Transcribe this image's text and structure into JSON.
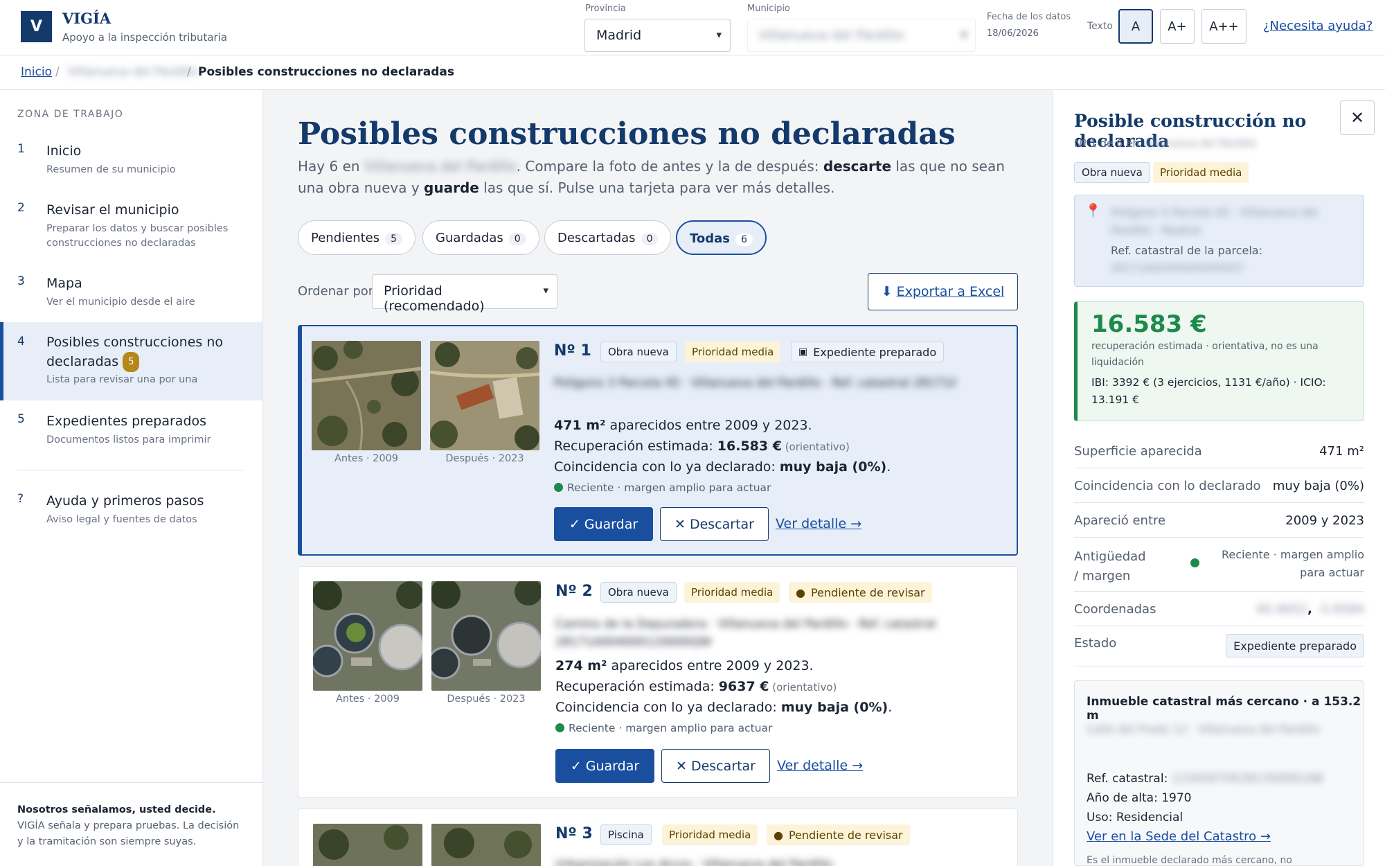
{
  "header": {
    "logo_letter": "V",
    "app_name": "VIGÍA",
    "app_sub": "Apoyo a la inspección tributaria",
    "provincia_label": "Provincia",
    "provincia_value": "Madrid",
    "municipio_label": "Municipio",
    "municipio_value": "Villanueva del Pardillo",
    "fecha_label": "Fecha de los datos",
    "fecha_value": "18/06/2026",
    "texto_label": "Texto",
    "text_sizes": [
      "A",
      "A+",
      "A++"
    ],
    "help_link": "¿Necesita ayuda?"
  },
  "breadcrumb": {
    "home": "Inicio",
    "municipio": "Villanueva del Pardillo",
    "current": "Posibles construcciones no declaradas"
  },
  "sidebar": {
    "zone_label": "ZONA DE TRABAJO",
    "items": [
      {
        "num": "1",
        "title": "Inicio",
        "desc": "Resumen de su municipio"
      },
      {
        "num": "2",
        "title": "Revisar el municipio",
        "desc": "Preparar los datos y buscar posibles construcciones no declaradas"
      },
      {
        "num": "3",
        "title": "Mapa",
        "desc": "Ver el municipio desde el aire"
      },
      {
        "num": "4",
        "title": "Posibles construcciones no declaradas",
        "badge": "5",
        "desc": "Lista para revisar una por una"
      },
      {
        "num": "5",
        "title": "Expedientes preparados",
        "desc": "Documentos listos para imprimir"
      },
      {
        "num": "?",
        "title": "Ayuda y primeros pasos",
        "desc": "Aviso legal y fuentes de datos"
      }
    ],
    "footer_bold": "Nosotros señalamos, usted decide.",
    "footer_text": "VIGÍA señala y prepara pruebas. La decisión y la tramitación son siempre suyas."
  },
  "main": {
    "title": "Posibles construcciones no declaradas",
    "intro_1": "Hay 6 en ",
    "intro_municipio": "Villanueva del Pardillo",
    "intro_2": ". Compare la foto de antes y la de después: ",
    "intro_b1": "descarte",
    "intro_3": " las que no sean una obra nueva y ",
    "intro_b2": "guarde",
    "intro_4": " las que sí. Pulse una tarjeta para ver más detalles.",
    "tabs": [
      {
        "label": "Pendientes",
        "count": "5"
      },
      {
        "label": "Guardadas",
        "count": "0"
      },
      {
        "label": "Descartadas",
        "count": "0"
      },
      {
        "label": "Todas",
        "count": "6"
      }
    ],
    "sort_label": "Ordenar por",
    "sort_value": "Prioridad (recomendado)",
    "export_label": "Exportar a Excel"
  },
  "cards": [
    {
      "num": "Nº 1",
      "type": "Obra nueva",
      "priority": "Prioridad media",
      "status": "Expediente preparado",
      "address": "Polígono 3 Parcela 45 · Villanueva del Pardillo · Ref. catastral 28171A003000450000XY",
      "m2": "471 m²",
      "m2_text": " aparecidos entre 2009 y 2023.",
      "rec_label": "Recuperación estimada: ",
      "rec_value": "16.583 €",
      "rec_note": " (orientativo)",
      "coin_label": "Coincidencia con lo ya declarado: ",
      "coin_value": "muy baja (0%)",
      "coin_end": ".",
      "recent": "Reciente · margen amplio para actuar",
      "before_cap": "Antes · 2009",
      "after_cap": "Después · 2023"
    },
    {
      "num": "Nº 2",
      "type": "Obra nueva",
      "priority": "Prioridad media",
      "status": "Pendiente de revisar",
      "address": "Camino de la Depuradora · Villanueva del Pardillo · Ref. catastral 28171A004000120000QW",
      "m2": "274 m²",
      "m2_text": " aparecidos entre 2009 y 2023.",
      "rec_label": "Recuperación estimada: ",
      "rec_value": "9637 €",
      "rec_note": " (orientativo)",
      "coin_label": "Coincidencia con lo ya declarado: ",
      "coin_value": "muy baja (0%)",
      "coin_end": ".",
      "recent": "Reciente · margen amplio para actuar",
      "before_cap": "Antes · 2009",
      "after_cap": "Después · 2023"
    },
    {
      "num": "Nº 3",
      "type": "Piscina",
      "priority": "Prioridad media",
      "status": "Pendiente de revisar",
      "address": "Urbanización Los Arcos · Villanueva del Pardillo"
    }
  ],
  "buttons": {
    "save": "✓ Guardar",
    "discard": "✕ Descartar",
    "detail": "Ver detalle →"
  },
  "panel": {
    "title": "Posible construcción no declarada",
    "sub_prefix": "Nº 1 de 6 en ",
    "sub_municipio": "Villanueva del Pardillo",
    "type": "Obra nueva",
    "priority": "Prioridad media",
    "address": "Polígono 3 Parcela 45 · Villanueva del Pardillo · Madrid",
    "ref_label": "Ref. catastral de la parcela:",
    "ref_value": "28171A003000450000XY",
    "amount": "16.583 €",
    "amount_sub": "recuperación estimada · orientativa, no es una liquidación",
    "amount_detail": "IBI: 3392 € (3 ejercicios, 1131 €/año) · ICIO: 13.191 €",
    "rows": [
      {
        "k": "Superficie aparecida",
        "v": "471 m²"
      },
      {
        "k": "Coincidencia con lo declarado",
        "v": "muy baja (0%)"
      },
      {
        "k": "Apareció entre",
        "v": "2009 y 2023"
      },
      {
        "k": "Antigüedad / margen",
        "v": "Reciente · margen amplio para actuar"
      },
      {
        "k": "Coordenadas",
        "v_a": "40.4652",
        "v_sep": ",",
        "v_b": "-3.9584"
      },
      {
        "k": "Estado",
        "v": "Expediente preparado"
      }
    ],
    "near_title": "Inmueble catastral más cercano · a 153.2 m",
    "near_address": "Calle del Prado 12 · Villanueva del Pardillo",
    "near_ref_label": "Ref. catastral: ",
    "near_ref_value": "1234567VK2813S0001AB",
    "near_year": "Año de alta: 1970",
    "near_use": "Uso: Residencial",
    "near_link": "Ver en la Sede del Catastro →",
    "near_note": "Es el inmueble declarado más cercano, no"
  },
  "colors": {
    "accent": "#143a6b",
    "link": "#1a4fa0",
    "green": "#1d8a4b",
    "gold": "#b6871a"
  }
}
